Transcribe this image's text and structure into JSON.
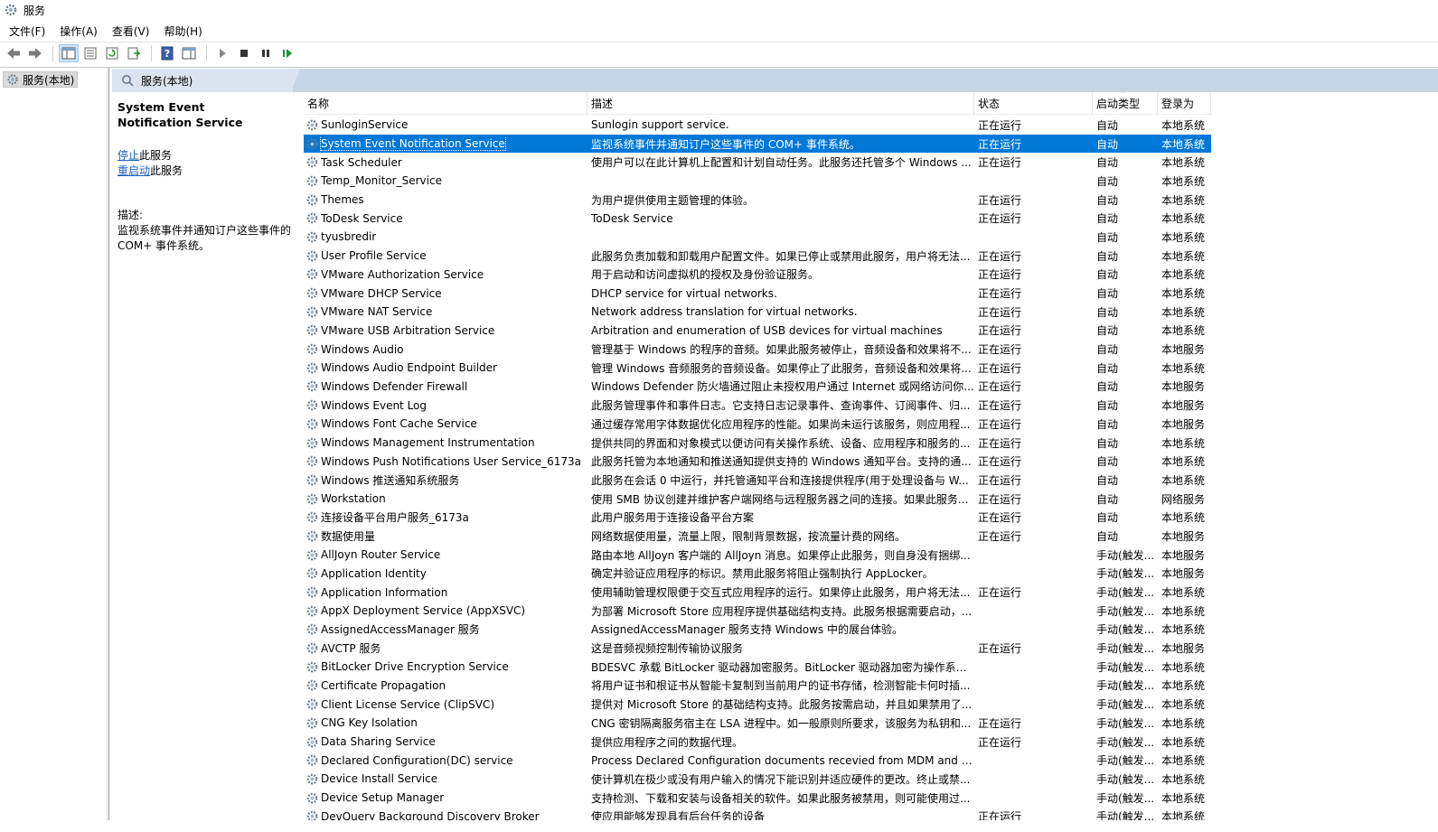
{
  "window": {
    "title": "服务"
  },
  "menu": [
    "文件(F)",
    "操作(A)",
    "查看(V)",
    "帮助(H)"
  ],
  "toolbar_icons": [
    "back-arrow-icon",
    "forward-arrow-icon",
    "show-tree-icon",
    "properties-icon",
    "refresh-icon",
    "export-list-icon",
    "help-icon",
    "show-action-pane-icon",
    "start-service-icon",
    "stop-service-icon",
    "pause-service-icon",
    "resume-service-icon"
  ],
  "tree": {
    "root_label": "服务(本地)"
  },
  "header": {
    "tab_label": "服务(本地)"
  },
  "desc_pane": {
    "service_title": "System Event Notification Service",
    "stop_link": "停止",
    "stop_suffix": "此服务",
    "restart_link": "重启动",
    "restart_suffix": "此服务",
    "desc_label": "描述:",
    "desc_text": "监视系统事件并通知订户这些事件的 COM+ 事件系统。"
  },
  "columns": {
    "name": "名称",
    "description": "描述",
    "status": "状态",
    "startup": "启动类型",
    "logon": "登录为"
  },
  "colors": {
    "selection": "#0078d7",
    "header_band": "#c5d5e6",
    "link": "#1a5fb4"
  },
  "selected_index": 1,
  "services": [
    {
      "name": "SunloginService",
      "desc": "Sunlogin support service.",
      "status": "正在运行",
      "start": "自动",
      "logon": "本地系统"
    },
    {
      "name": "System Event Notification Service",
      "desc": "监视系统事件并通知订户这些事件的 COM+ 事件系统。",
      "status": "正在运行",
      "start": "自动",
      "logon": "本地系统"
    },
    {
      "name": "Task Scheduler",
      "desc": "使用户可以在此计算机上配置和计划自动任务。此服务还托管多个 Windows ...",
      "status": "正在运行",
      "start": "自动",
      "logon": "本地系统"
    },
    {
      "name": "Temp_Monitor_Service",
      "desc": "",
      "status": "",
      "start": "自动",
      "logon": "本地系统"
    },
    {
      "name": "Themes",
      "desc": "为用户提供使用主题管理的体验。",
      "status": "正在运行",
      "start": "自动",
      "logon": "本地系统"
    },
    {
      "name": "ToDesk Service",
      "desc": "ToDesk Service",
      "status": "正在运行",
      "start": "自动",
      "logon": "本地系统"
    },
    {
      "name": "tyusbredir",
      "desc": "",
      "status": "",
      "start": "自动",
      "logon": "本地系统"
    },
    {
      "name": "User Profile Service",
      "desc": "此服务负责加载和卸载用户配置文件。如果已停止或禁用此服务，用户将无法...",
      "status": "正在运行",
      "start": "自动",
      "logon": "本地系统"
    },
    {
      "name": "VMware Authorization Service",
      "desc": "用于启动和访问虚拟机的授权及身份验证服务。",
      "status": "正在运行",
      "start": "自动",
      "logon": "本地系统"
    },
    {
      "name": "VMware DHCP Service",
      "desc": "DHCP service for virtual networks.",
      "status": "正在运行",
      "start": "自动",
      "logon": "本地系统"
    },
    {
      "name": "VMware NAT Service",
      "desc": "Network address translation for virtual networks.",
      "status": "正在运行",
      "start": "自动",
      "logon": "本地系统"
    },
    {
      "name": "VMware USB Arbitration Service",
      "desc": "Arbitration and enumeration of USB devices for virtual machines",
      "status": "正在运行",
      "start": "自动",
      "logon": "本地系统"
    },
    {
      "name": "Windows Audio",
      "desc": "管理基于 Windows 的程序的音频。如果此服务被停止，音频设备和效果将不...",
      "status": "正在运行",
      "start": "自动",
      "logon": "本地服务"
    },
    {
      "name": "Windows Audio Endpoint Builder",
      "desc": "管理 Windows 音频服务的音频设备。如果停止了此服务，音频设备和效果将...",
      "status": "正在运行",
      "start": "自动",
      "logon": "本地系统"
    },
    {
      "name": "Windows Defender Firewall",
      "desc": "Windows Defender 防火墙通过阻止未授权用户通过 Internet 或网络访问你...",
      "status": "正在运行",
      "start": "自动",
      "logon": "本地服务"
    },
    {
      "name": "Windows Event Log",
      "desc": "此服务管理事件和事件日志。它支持日志记录事件、查询事件、订阅事件、归...",
      "status": "正在运行",
      "start": "自动",
      "logon": "本地服务"
    },
    {
      "name": "Windows Font Cache Service",
      "desc": "通过缓存常用字体数据优化应用程序的性能。如果尚未运行该服务，则应用程...",
      "status": "正在运行",
      "start": "自动",
      "logon": "本地服务"
    },
    {
      "name": "Windows Management Instrumentation",
      "desc": "提供共同的界面和对象模式以便访问有关操作系统、设备、应用程序和服务的...",
      "status": "正在运行",
      "start": "自动",
      "logon": "本地系统"
    },
    {
      "name": "Windows Push Notifications User Service_6173a",
      "desc": "此服务托管为本地通知和推送通知提供支持的 Windows 通知平台。支持的通...",
      "status": "正在运行",
      "start": "自动",
      "logon": "本地系统"
    },
    {
      "name": "Windows 推送通知系统服务",
      "desc": "此服务在会话 0 中运行，并托管通知平台和连接提供程序(用于处理设备与 W...",
      "status": "正在运行",
      "start": "自动",
      "logon": "本地系统"
    },
    {
      "name": "Workstation",
      "desc": "使用 SMB 协议创建并维护客户端网络与远程服务器之间的连接。如果此服务...",
      "status": "正在运行",
      "start": "自动",
      "logon": "网络服务"
    },
    {
      "name": "连接设备平台用户服务_6173a",
      "desc": "此用户服务用于连接设备平台方案",
      "status": "正在运行",
      "start": "自动",
      "logon": "本地系统"
    },
    {
      "name": "数据使用量",
      "desc": "网络数据使用量，流量上限，限制背景数据，按流量计费的网络。",
      "status": "正在运行",
      "start": "自动",
      "logon": "本地服务"
    },
    {
      "name": "AllJoyn Router Service",
      "desc": "路由本地 AllJoyn 客户端的 AllJoyn 消息。如果停止此服务，则自身没有捆绑...",
      "status": "",
      "start": "手动(触发...",
      "logon": "本地服务"
    },
    {
      "name": "Application Identity",
      "desc": "确定并验证应用程序的标识。禁用此服务将阻止强制执行 AppLocker。",
      "status": "",
      "start": "手动(触发...",
      "logon": "本地服务"
    },
    {
      "name": "Application Information",
      "desc": "使用辅助管理权限便于交互式应用程序的运行。如果停止此服务，用户将无法...",
      "status": "正在运行",
      "start": "手动(触发...",
      "logon": "本地系统"
    },
    {
      "name": "AppX Deployment Service (AppXSVC)",
      "desc": "为部署 Microsoft Store 应用程序提供基础结构支持。此服务根据需要启动，...",
      "status": "",
      "start": "手动(触发...",
      "logon": "本地系统"
    },
    {
      "name": "AssignedAccessManager 服务",
      "desc": "AssignedAccessManager 服务支持 Windows 中的展台体验。",
      "status": "",
      "start": "手动(触发...",
      "logon": "本地系统"
    },
    {
      "name": "AVCTP 服务",
      "desc": "这是音频视频控制传输协议服务",
      "status": "正在运行",
      "start": "手动(触发...",
      "logon": "本地服务"
    },
    {
      "name": "BitLocker Drive Encryption Service",
      "desc": "BDESVC 承载 BitLocker 驱动器加密服务。BitLocker 驱动器加密为操作系统...",
      "status": "",
      "start": "手动(触发...",
      "logon": "本地系统"
    },
    {
      "name": "Certificate Propagation",
      "desc": "将用户证书和根证书从智能卡复制到当前用户的证书存储，检测智能卡何时插...",
      "status": "",
      "start": "手动(触发...",
      "logon": "本地系统"
    },
    {
      "name": "Client License Service (ClipSVC)",
      "desc": "提供对 Microsoft Store 的基础结构支持。此服务按需启动，并且如果禁用了...",
      "status": "",
      "start": "手动(触发...",
      "logon": "本地系统"
    },
    {
      "name": "CNG Key Isolation",
      "desc": "CNG 密钥隔离服务宿主在 LSA 进程中。如一般原则所要求，该服务为私钥和...",
      "status": "正在运行",
      "start": "手动(触发...",
      "logon": "本地系统"
    },
    {
      "name": "Data Sharing Service",
      "desc": "提供应用程序之间的数据代理。",
      "status": "正在运行",
      "start": "手动(触发...",
      "logon": "本地系统"
    },
    {
      "name": "Declared Configuration(DC) service",
      "desc": "Process Declared Configuration documents recevied from MDM and o...",
      "status": "",
      "start": "手动(触发...",
      "logon": "本地系统"
    },
    {
      "name": "Device Install Service",
      "desc": "使计算机在极少或没有用户输入的情况下能识别并适应硬件的更改。终止或禁...",
      "status": "",
      "start": "手动(触发...",
      "logon": "本地系统"
    },
    {
      "name": "Device Setup Manager",
      "desc": "支持检测、下载和安装与设备相关的软件。如果此服务被禁用，则可能使用过...",
      "status": "",
      "start": "手动(触发...",
      "logon": "本地系统"
    },
    {
      "name": "DevQuery Background Discovery Broker",
      "desc": "使应用能够发现具有后台任务的设备",
      "status": "正在运行",
      "start": "手动(触发...",
      "logon": "本地系统"
    }
  ]
}
